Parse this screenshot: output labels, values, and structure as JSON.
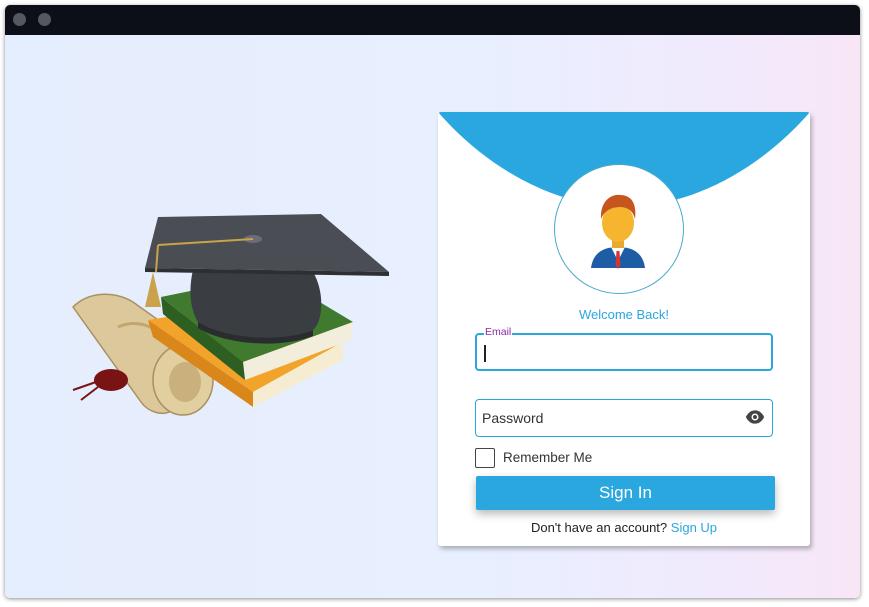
{
  "login": {
    "welcome": "Welcome Back!",
    "email_label": "Email",
    "email_value": "",
    "password_placeholder": "Password",
    "password_value": "",
    "remember_label": "Remember Me",
    "remember_checked": false,
    "signin_label": "Sign In",
    "signup_prompt": "Don't have an account?",
    "signup_link": "Sign Up"
  },
  "icons": {
    "avatar": "user-avatar-icon",
    "password_toggle": "eye-icon",
    "illustration": "graduation-cap-books-diploma"
  },
  "colors": {
    "accent": "#2aa7df",
    "float_label": "#8a2aa6",
    "titlebar": "#0c0f18"
  }
}
